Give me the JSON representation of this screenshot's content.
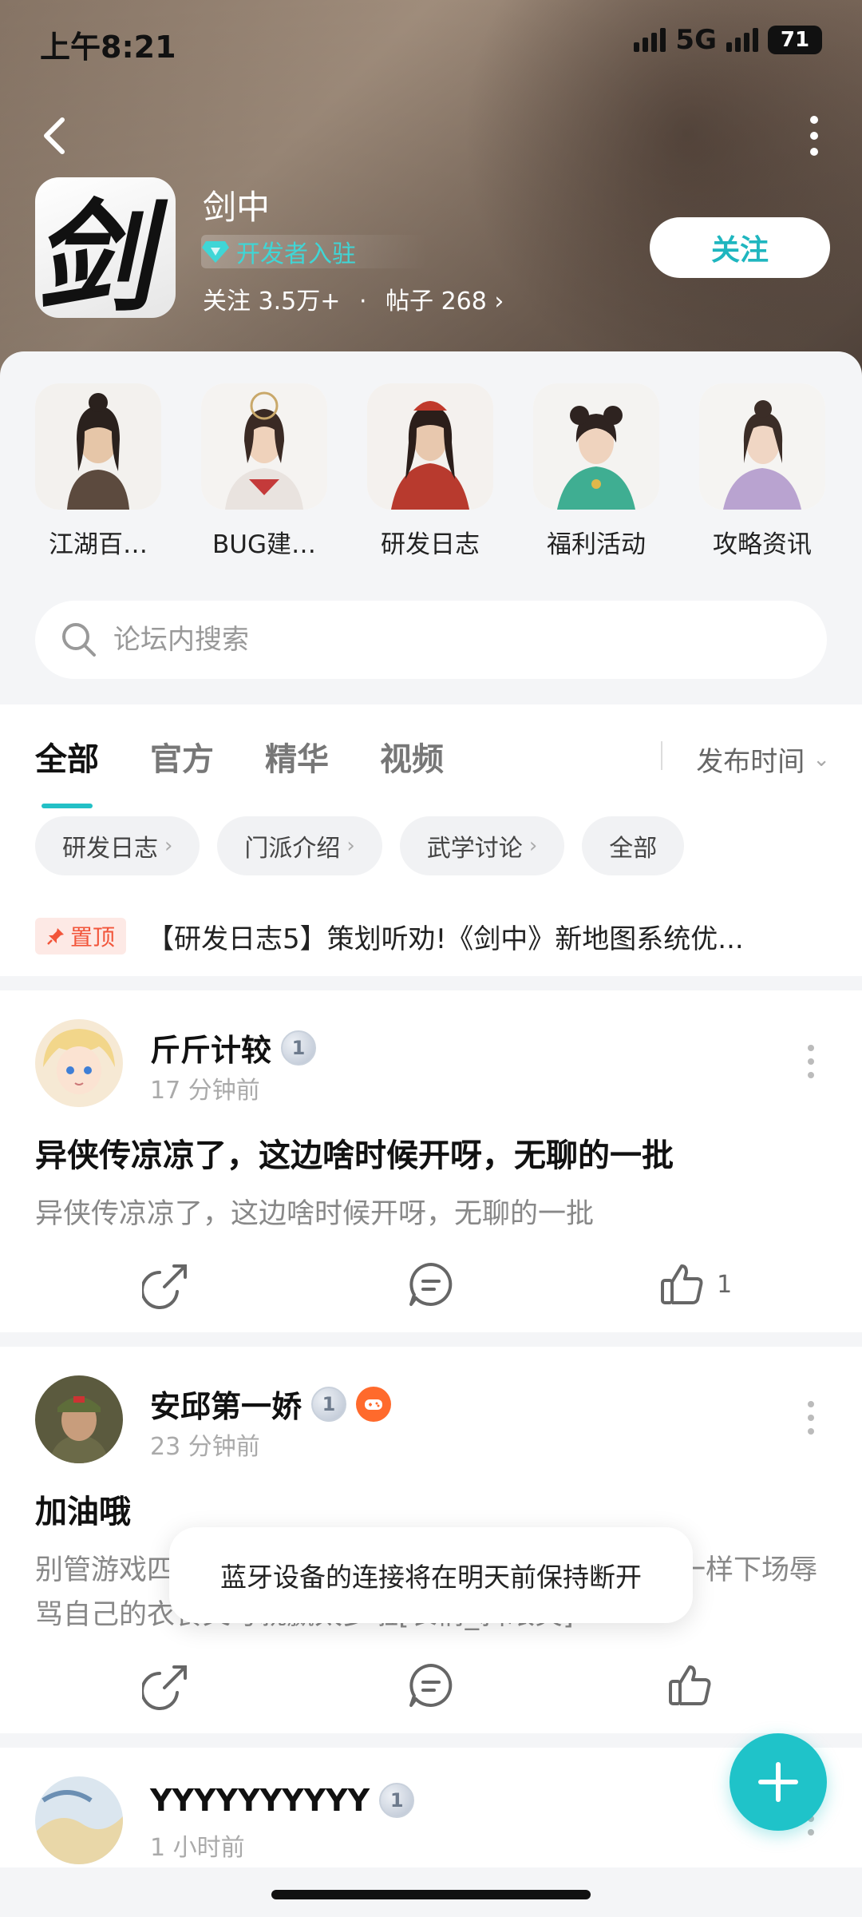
{
  "status_bar": {
    "time": "上午8:21",
    "network": "5G",
    "battery": "71"
  },
  "forum": {
    "logo_glyph": "剑",
    "name": "剑中",
    "badge": "开发者入驻",
    "follow_label": "关注",
    "followers_label": "关注",
    "followers": "3.5万+",
    "dot": "·",
    "posts_label": "帖子",
    "posts": "268",
    "posts_chevron": "›",
    "follow_button": "关注"
  },
  "shortcuts": [
    {
      "label": "江湖百…"
    },
    {
      "label": "BUG建…"
    },
    {
      "label": "研发日志"
    },
    {
      "label": "福利活动"
    },
    {
      "label": "攻略资讯"
    }
  ],
  "search": {
    "placeholder": "论坛内搜索"
  },
  "tabs": [
    {
      "label": "全部"
    },
    {
      "label": "官方"
    },
    {
      "label": "精华"
    },
    {
      "label": "视频"
    }
  ],
  "sort": {
    "label": "发布时间",
    "chevron": "⌄"
  },
  "chips": [
    {
      "label": "研发日志",
      "chevron": "›"
    },
    {
      "label": "门派介绍",
      "chevron": "›"
    },
    {
      "label": "武学讨论",
      "chevron": "›"
    },
    {
      "label": "全部"
    }
  ],
  "pinned": {
    "tag": "置顶",
    "title": "【研发日志5】策划听劝!《剑中》新地图系统优..."
  },
  "posts": [
    {
      "author": "斤斤计较",
      "level": "1",
      "time": "17 分钟前",
      "title": "异侠传凉凉了，这边啥时候开呀，无聊的一批",
      "body": "异侠传凉凉了，这边啥时候开呀，无聊的一批",
      "likes": "1"
    },
    {
      "author": "安邱第一娇",
      "level": "1",
      "time": "23 分钟前",
      "title": "加油哦",
      "body": "别管游戏四千元大玩但十四相当子兴中安心那俩奇葩一样下场辱骂自己的衣食父母就赢太多啦[表情_斜眼笑]",
      "likes": ""
    },
    {
      "author": "YYYYYYYYYY",
      "level": "1",
      "time": "1 小时前"
    }
  ],
  "toast": {
    "text": "蓝牙设备的连接将在明天前保持断开"
  },
  "colors": {
    "accent": "#1fc3c9",
    "pin": "#f2553a",
    "badge_text": "#3fd6d6"
  }
}
